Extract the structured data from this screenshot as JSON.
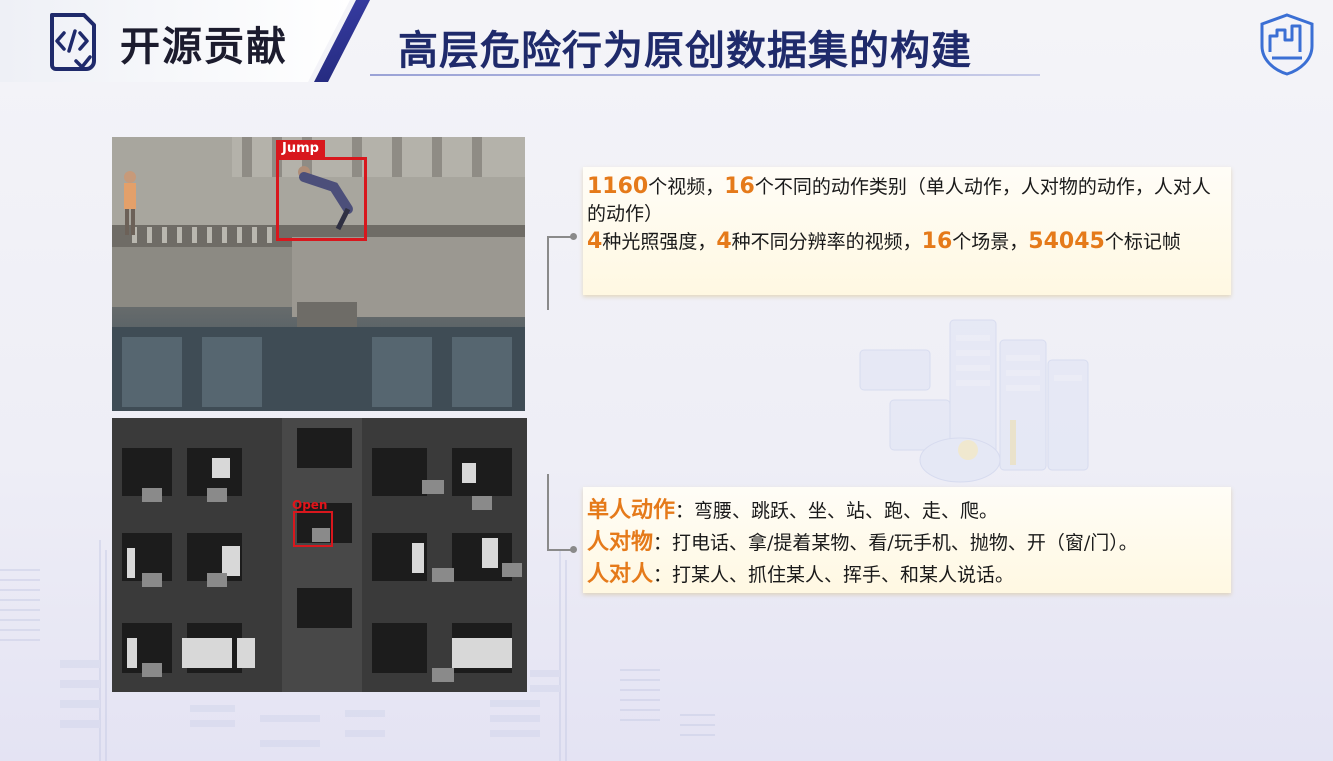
{
  "header": {
    "section_label": "开源贡献",
    "title": "高层危险行为原创数据集的构建"
  },
  "photos": {
    "top": {
      "detection_label": "Jump"
    },
    "bottom": {
      "detection_label": "Open"
    }
  },
  "stats_card": {
    "line1": {
      "n1": "1160",
      "t1": "个视频，",
      "n2": "16",
      "t2": "个不同的动作类别（单人动作，人对物的动作，人对人的动作）"
    },
    "line2": {
      "n1": "4",
      "t1": "种光照强度，",
      "n2": "4",
      "t2": "种不同分辨率的视频，",
      "n3": "16",
      "t3": "个场景，",
      "n4": "54045",
      "t4": "个标记帧"
    }
  },
  "actions_card": {
    "items": [
      {
        "key": "单人动作",
        "text": "：弯腰、跳跃、坐、站、跑、走、爬。"
      },
      {
        "key": "人对物",
        "text": "：打电话、拿/提着某物、看/玩手机、抛物、开（窗/门）。"
      },
      {
        "key": "人对人",
        "text": "：打某人、抓住某人、挥手、和某人说话。"
      }
    ]
  },
  "colors": {
    "accent": "#e57a1a",
    "title": "#1f2a6b",
    "detection": "#d8171d",
    "card_bg": "#fff8e2"
  },
  "icons": {
    "section": "code-file-icon",
    "logo": "shield-city-logo-icon"
  }
}
